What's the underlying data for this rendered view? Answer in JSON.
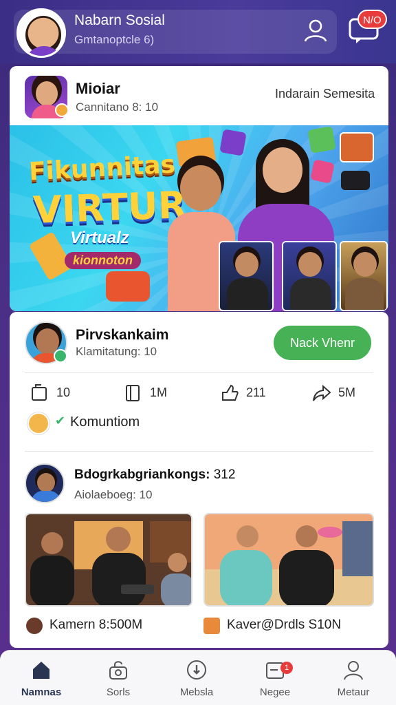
{
  "header": {
    "title": "Nabarn Sosial",
    "subtitle": "Gmtanoptcle 6)",
    "chat_badge": "N/O",
    "user_icon": "user-icon",
    "chat_icon": "chat-icon"
  },
  "post1": {
    "name": "Mioiar",
    "meta": "Cannitano 8: 10",
    "right_label": "Indarain Semesita",
    "banner": {
      "line1": "Fikunnitas",
      "line2": "VIRTUR",
      "line3": "Virtualz",
      "line4": "kionnoton"
    }
  },
  "post2": {
    "name": "Pirvskankaim",
    "meta": "Klamitatung: 10",
    "follow_label": "Nack Vhenr",
    "stats": [
      {
        "icon": "page-icon",
        "value": "10"
      },
      {
        "icon": "book-icon",
        "value": "1M"
      },
      {
        "icon": "like-icon",
        "value": "211"
      },
      {
        "icon": "share-icon",
        "value": "5M"
      }
    ],
    "comment_label": "Komuntiom"
  },
  "post3": {
    "name": "Bdogrkabgriankongs:",
    "name_count": "312",
    "meta": "Aiolaeboeg: 10",
    "captions": [
      {
        "icon": "game-icon",
        "text": "Kamern 8:500M"
      },
      {
        "icon": "puzzle-icon",
        "text": "Kaver@Drdls S10N"
      }
    ]
  },
  "nav": [
    {
      "label": "Namnas",
      "icon": "home-icon",
      "active": true
    },
    {
      "label": "Sorls",
      "icon": "camera-lock-icon",
      "active": false
    },
    {
      "label": "Mebsla",
      "icon": "compass-icon",
      "active": false
    },
    {
      "label": "Negee",
      "icon": "inbox-icon",
      "badge": "1",
      "active": false
    },
    {
      "label": "Metaur",
      "icon": "profile-icon",
      "active": false
    }
  ],
  "colors": {
    "background_top": "#3a2a7a",
    "follow_button": "#47b156",
    "badge": "#e83c3c",
    "banner": "#2bc0e8"
  }
}
